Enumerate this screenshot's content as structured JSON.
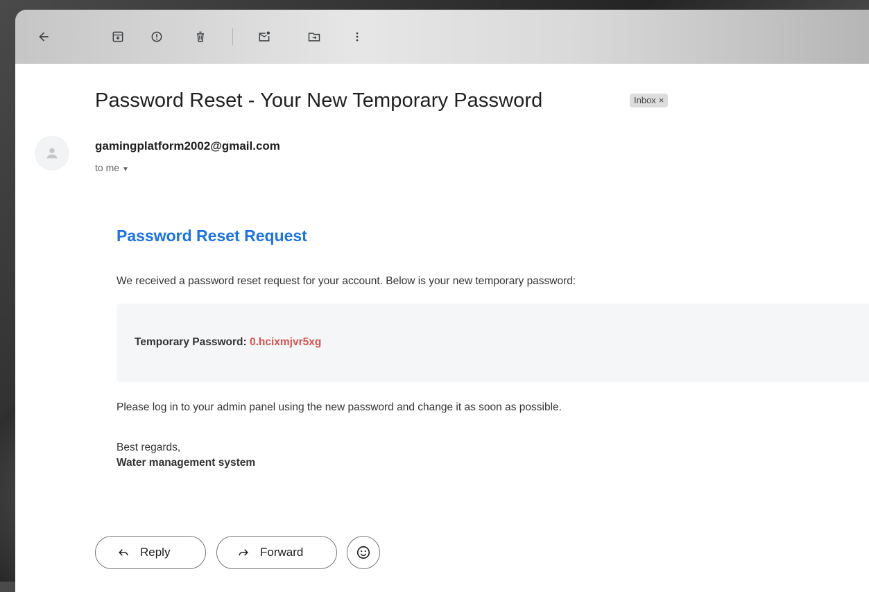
{
  "email": {
    "subject": "Password Reset - Your New Temporary Password",
    "label": "Inbox",
    "label_close": "×",
    "sender": "gamingplatform2002@gmail.com",
    "recipient": "to me",
    "body": {
      "heading": "Password Reset Request",
      "intro": "We received a password reset request for your account. Below is your new temporary password:",
      "password_label": "Temporary Password: ",
      "password_value": "0.hcixmjvr5xg",
      "instruction": "Please log in to your admin panel using the new password and change it as soon as possible.",
      "closing": "Best regards,",
      "organization": "Water management system"
    }
  },
  "actions": {
    "reply_label": "Reply",
    "forward_label": "Forward"
  },
  "toolbar": {
    "icons": [
      "back-arrow-icon",
      "archive-icon",
      "report-spam-icon",
      "delete-icon",
      "mark-unread-icon",
      "move-to-icon",
      "more-options-icon"
    ]
  },
  "colors": {
    "heading_blue": "#1a73e8",
    "password_red": "#d9534f",
    "label_bg": "#dddddd",
    "password_box_bg": "#f5f6f7"
  }
}
